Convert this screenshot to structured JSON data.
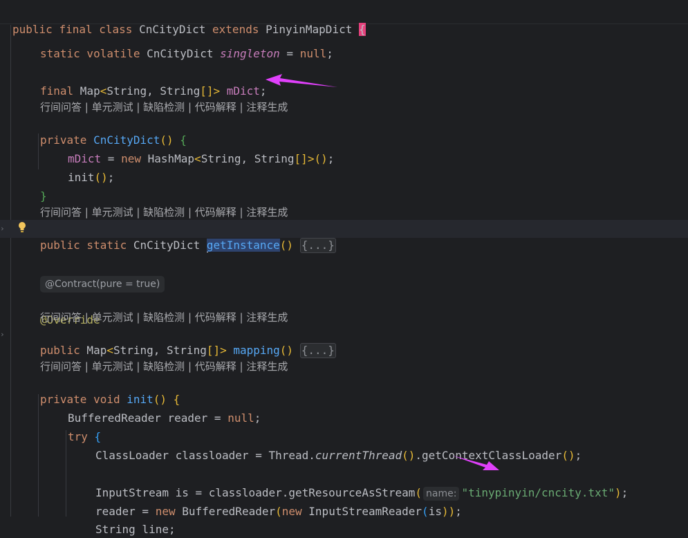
{
  "header_line": {
    "kw_public": "public",
    "kw_final": "final",
    "kw_class": "class",
    "class_name": "CnCityDict",
    "kw_extends": "extends",
    "parent": "PinyinMapDict",
    "open_brace": "{"
  },
  "hint_text": "行间问答 | 单元测试 | 缺陷检测 | 代码解释 | 注释生成",
  "contract_hint": "@Contract(pure = true)",
  "param_hint": "name:",
  "code": {
    "l1": {
      "kw": "static volatile",
      "type": " CnCityDict ",
      "field": "singleton",
      "rest": " = ",
      "null": "null",
      "semi": ";"
    },
    "l2": {
      "kw": "final",
      "type": " Map",
      "lt": "<",
      "generic": "String, String",
      "arr": "[]",
      "gt": ">",
      "field": " mDict",
      "semi": ";"
    },
    "l3": {
      "kw": "private",
      "fn": " CnCityDict",
      "paren": "()",
      "brace": " {"
    },
    "l4": {
      "field": "mDict",
      "eq": " = ",
      "kw": "new",
      "type": " HashMap",
      "lt": "<",
      "generic": "String, String",
      "arr": "[]",
      "gt": ">",
      "paren": "()",
      "semi": ";"
    },
    "l5": {
      "call": "init",
      "paren": "()",
      "semi": ";"
    },
    "l6": {
      "brace": "}"
    },
    "l7": {
      "kw": "public static",
      "type": " CnCityDict ",
      "fn": "getInstance",
      "paren": "()",
      "fold": "{...}"
    },
    "l8": {
      "ann": "@Override"
    },
    "l9": {
      "kw": "public",
      "type": " Map",
      "lt": "<",
      "generic": "String, String",
      "arr": "[]",
      "gt": ">",
      "fn": " mapping",
      "paren": "()",
      "fold": "{...}"
    },
    "l10": {
      "kw": "private void",
      "fn": " init",
      "paren": "()",
      "brace": " {"
    },
    "l11": {
      "type": "BufferedReader reader = ",
      "null": "null",
      "semi": ";"
    },
    "l12": {
      "kw": "try",
      "brace": " {"
    },
    "l13": {
      "type": "ClassLoader classloader = Thread.",
      "ital": "currentThread",
      "p1": "()",
      "dot": ".getContextClassLoader",
      "p2": "()",
      "semi": ";"
    },
    "l14": {
      "type": "InputStream is = classloader.getResourceAsStream",
      "paren_open": "(",
      "str": "\"tinypinyin/cncity.txt\"",
      "paren_close": ")",
      "semi": ";"
    },
    "l15": {
      "type": "reader = ",
      "kw": "new",
      "t2": " BufferedReader",
      "p1": "(",
      "kw2": "new",
      "t3": " InputStreamReader",
      "p2": "(",
      "arg": "is",
      "p3": "))",
      "semi": ";"
    },
    "l16": {
      "type": "String line",
      "semi": ";"
    }
  },
  "colors": {
    "background": "#1e1f22",
    "keyword": "#cf8e6d",
    "function": "#56a8f5",
    "field": "#c77dbb",
    "string": "#6aab73",
    "annotation": "#b3ae60",
    "arrow": "#e040fb"
  },
  "icons": [
    "lightbulb-icon",
    "fold-arrow-icon",
    "annotation-arrow-icon"
  ]
}
